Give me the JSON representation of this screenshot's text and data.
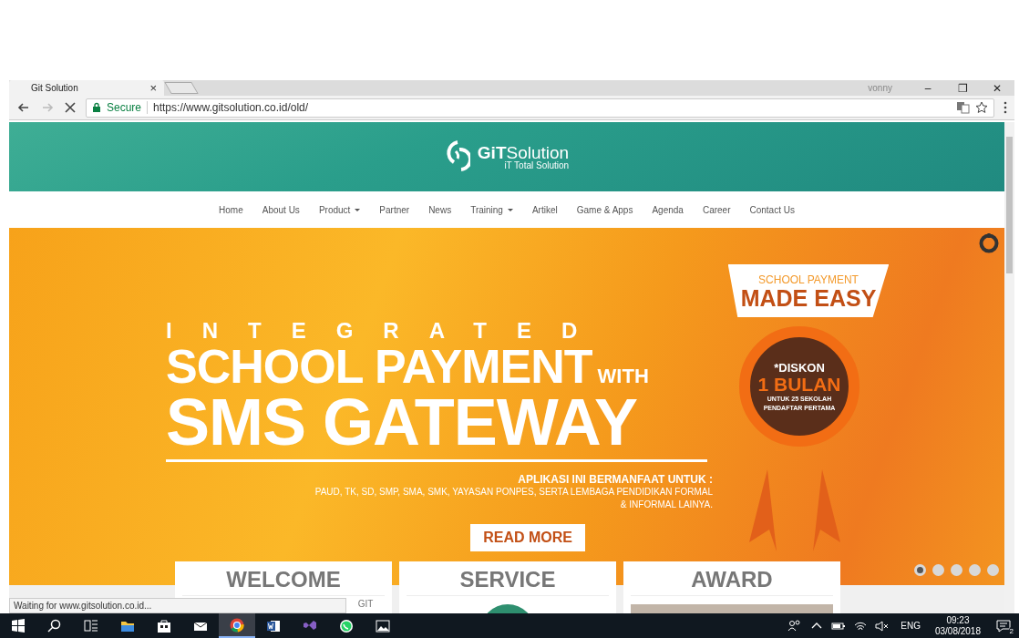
{
  "browser": {
    "tab": {
      "title": "Git Solution",
      "close": "×"
    },
    "user": "vonny",
    "window_buttons": [
      "–",
      "❐",
      "✕"
    ],
    "secure_label": "Secure",
    "url": "https://www.gitsolution.co.id/old/",
    "status": "Waiting for www.gitsolution.co.id..."
  },
  "site": {
    "logo": "**GiT**Solution",
    "tagline": "iT Total Solution",
    "nav": [
      {
        "label": "Home",
        "dropdown": false
      },
      {
        "label": "About Us",
        "dropdown": false
      },
      {
        "label": "Product",
        "dropdown": true
      },
      {
        "label": "Partner",
        "dropdown": false
      },
      {
        "label": "News",
        "dropdown": false
      },
      {
        "label": "Training",
        "dropdown": true
      },
      {
        "label": "Artikel",
        "dropdown": false
      },
      {
        "label": "Game & Apps",
        "dropdown": false
      },
      {
        "label": "Agenda",
        "dropdown": false
      },
      {
        "label": "Career",
        "dropdown": false
      },
      {
        "label": "Contact Us",
        "dropdown": false
      }
    ],
    "banner": {
      "kicker": "INTEGRATED",
      "headline_1": "SCHOOL PAYMENT",
      "with": "WITH",
      "headline_2": "SMS GATEWAY",
      "bubble_small": "SCHOOL PAYMENT",
      "bubble_big": "MADE EASY",
      "badge_top": "*DISKON",
      "badge_big": "1 BULAN",
      "badge_note": "UNTUK 25 SEKOLAH PENDAFTAR PERTAMA",
      "benefit_title": "APLIKASI INI BERMANFAAT UNTUK :",
      "benefit_body": "PAUD, TK, SD, SMP, SMA, SMK, YAYASAN PONPES, SERTA LEMBAGA PENDIDIKAN FORMAL & INFORMAL LAINYA.",
      "button": "READ MORE",
      "dots": [
        {
          "selected": true
        },
        {
          "selected": false
        },
        {
          "selected": false
        },
        {
          "selected": false
        },
        {
          "selected": false
        }
      ]
    },
    "cards": [
      {
        "title": "WELCOME",
        "kind": "text"
      },
      {
        "title": "SERVICE",
        "kind": "circle"
      },
      {
        "title": "AWARD",
        "kind": "photo"
      }
    ],
    "card_note": "GIT"
  },
  "taskbar": {
    "apps": [
      {
        "kind": "start",
        "selected": false
      },
      {
        "kind": "search",
        "selected": false
      },
      {
        "kind": "taskview",
        "selected": false
      },
      {
        "kind": "folder",
        "selected": false
      },
      {
        "kind": "store",
        "selected": false
      },
      {
        "kind": "mail",
        "selected": false
      },
      {
        "kind": "chrome",
        "selected": true
      },
      {
        "kind": "word",
        "selected": false
      },
      {
        "kind": "vs",
        "selected": false
      },
      {
        "kind": "whatsapp",
        "selected": false
      },
      {
        "kind": "photos",
        "selected": false
      }
    ],
    "language": "ENG",
    "time": "09:23",
    "date": "03/08/2018",
    "notifications": "2"
  }
}
